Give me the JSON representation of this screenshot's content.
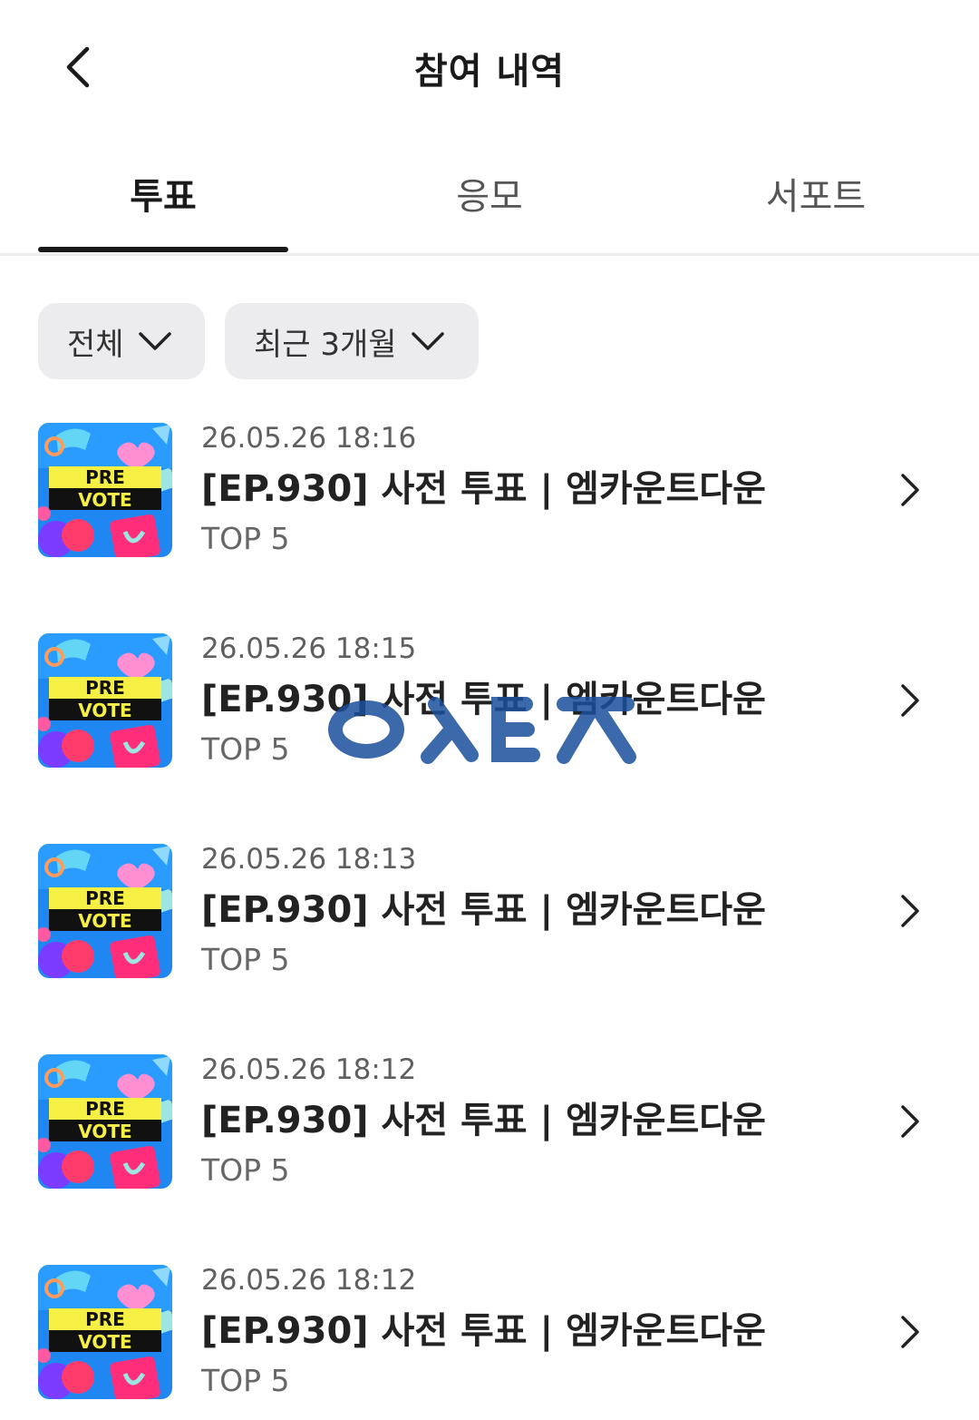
{
  "header": {
    "title": "참여 내역",
    "back_icon": "chevron-left-icon"
  },
  "tabs": [
    {
      "label": "투표",
      "active": true
    },
    {
      "label": "응모",
      "active": false
    },
    {
      "label": "서포트",
      "active": false
    }
  ],
  "filters": {
    "category": "전체",
    "period": "최근 3개월"
  },
  "list": [
    {
      "date": "26.05.26 18:16",
      "title": "[EP.930] 사전 투표 | 엠카운트다운",
      "rank": "TOP 5",
      "badge_line1": "PRE",
      "badge_line2": "VOTE"
    },
    {
      "date": "26.05.26 18:15",
      "title": "[EP.930] 사전 투표 | 엠카운트다운",
      "rank": "TOP 5",
      "badge_line1": "PRE",
      "badge_line2": "VOTE"
    },
    {
      "date": "26.05.26 18:13",
      "title": "[EP.930] 사전 투표 | 엠카운트다운",
      "rank": "TOP 5",
      "badge_line1": "PRE",
      "badge_line2": "VOTE"
    },
    {
      "date": "26.05.26 18:12",
      "title": "[EP.930] 사전 투표 | 엠카운트다운",
      "rank": "TOP 5",
      "badge_line1": "PRE",
      "badge_line2": "VOTE"
    },
    {
      "date": "26.05.26 18:12",
      "title": "[EP.930] 사전 투표 | 엠카운트다운",
      "rank": "TOP 5",
      "badge_line1": "PRE",
      "badge_line2": "VOTE"
    }
  ],
  "colors": {
    "accent": "#1a1a1a",
    "filter_bg": "#ececef",
    "thumb_bg": "#1f86f2",
    "badge_yellow": "#f6f044",
    "watermark": "#1a4f9c"
  }
}
